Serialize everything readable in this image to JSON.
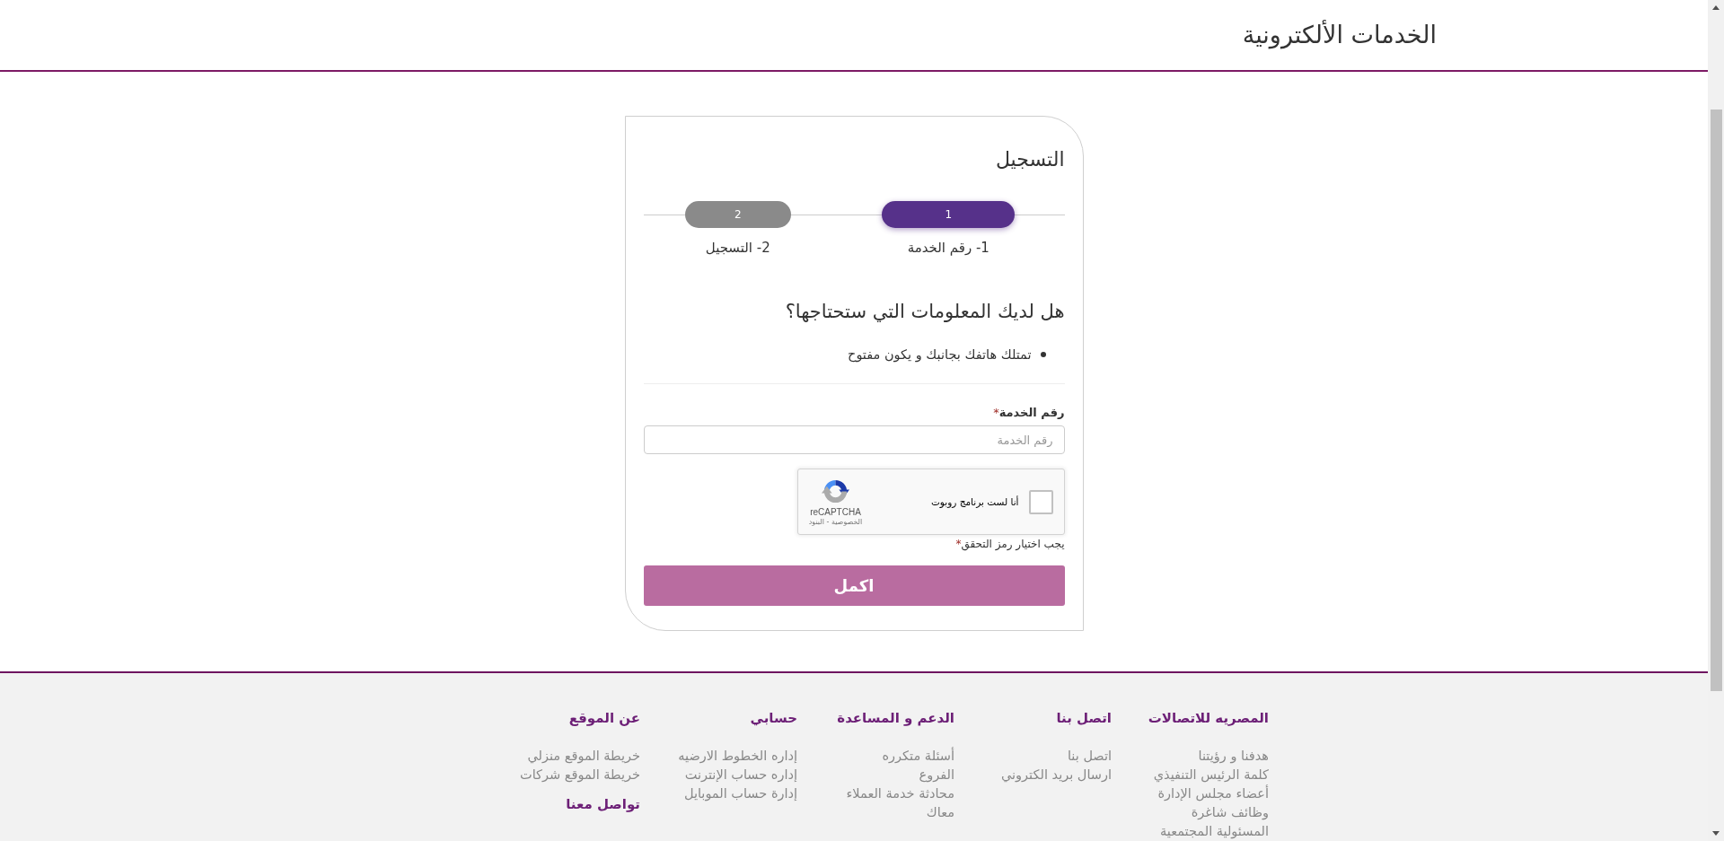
{
  "header": {
    "title": "الخدمات الألكترونية"
  },
  "registration": {
    "title": "التسجيل",
    "steps": [
      {
        "number": "1",
        "label": "1- رقم الخدمة",
        "selected": true
      },
      {
        "number": "2",
        "label": "2- التسجيل",
        "selected": false
      }
    ],
    "requirements": {
      "heading": "هل لديك المعلومات التي ستحتاجها؟",
      "items": [
        "تمتلك هاتفك بجانبك و يكون مفتوح"
      ]
    },
    "service_number": {
      "label": "رقم الخدمة",
      "required_mark": "*",
      "placeholder": "رقم الخدمة"
    },
    "captcha": {
      "label": "أنا لست برنامج روبوت",
      "checked": false,
      "brand": "reCAPTCHA",
      "links": "الخصوصية - البنود",
      "error": "يجب اختيار رمز التحقق",
      "error_mark": "*"
    },
    "submit": "اكمل"
  },
  "footer": {
    "columns": [
      {
        "sections": [
          {
            "title": "المصريه للاتصالات",
            "links": [
              "هدفنا و رؤيتنا",
              "كلمة الرئيس التنفيذي",
              "أعضاء مجلس الإدارة",
              "وظائف شاغرة",
              "المسئولية المجتمعية"
            ]
          }
        ]
      },
      {
        "sections": [
          {
            "title": "اتصل بنا",
            "links": [
              "اتصل بنا",
              "ارسال بريد الكتروني"
            ]
          }
        ]
      },
      {
        "sections": [
          {
            "title": "الدعم و المساعدة",
            "links": [
              "أسئلة متكرره",
              "الفروع",
              "محادثة خدمة العملاء",
              "معاك"
            ]
          }
        ]
      },
      {
        "sections": [
          {
            "title": "حسابي",
            "links": [
              "إداره الخطوط الارضيه",
              "إداره حساب الإنترنت",
              "إدارة حساب الموبايل"
            ]
          }
        ]
      },
      {
        "sections": [
          {
            "title": "عن الموقع",
            "links": [
              "خريطة الموقع منزلي",
              "خريطة الموقع شركات"
            ]
          },
          {
            "title": "تواصل معنا"
          }
        ]
      }
    ]
  }
}
